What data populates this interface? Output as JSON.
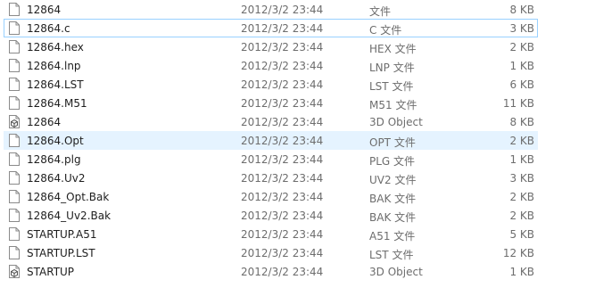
{
  "files": [
    {
      "name": "12864",
      "date": "2012/3/2 23:44",
      "type": "文件",
      "size": "8 KB",
      "icon": "file-icon"
    },
    {
      "name": "12864.c",
      "date": "2012/3/2 23:44",
      "type": "C 文件",
      "size": "3 KB",
      "icon": "file-icon",
      "state": "focused"
    },
    {
      "name": "12864.hex",
      "date": "2012/3/2 23:44",
      "type": "HEX 文件",
      "size": "2 KB",
      "icon": "file-icon"
    },
    {
      "name": "12864.lnp",
      "date": "2012/3/2 23:44",
      "type": "LNP 文件",
      "size": "1 KB",
      "icon": "file-icon"
    },
    {
      "name": "12864.LST",
      "date": "2012/3/2 23:44",
      "type": "LST 文件",
      "size": "6 KB",
      "icon": "file-icon"
    },
    {
      "name": "12864.M51",
      "date": "2012/3/2 23:44",
      "type": "M51 文件",
      "size": "11 KB",
      "icon": "file-icon"
    },
    {
      "name": "12864",
      "date": "2012/3/2 23:44",
      "type": "3D Object",
      "size": "8 KB",
      "icon": "3d-object-icon"
    },
    {
      "name": "12864.Opt",
      "date": "2012/3/2 23:44",
      "type": "OPT 文件",
      "size": "2 KB",
      "icon": "file-icon",
      "state": "hovered"
    },
    {
      "name": "12864.plg",
      "date": "2012/3/2 23:44",
      "type": "PLG 文件",
      "size": "1 KB",
      "icon": "file-icon"
    },
    {
      "name": "12864.Uv2",
      "date": "2012/3/2 23:44",
      "type": "UV2 文件",
      "size": "3 KB",
      "icon": "file-icon"
    },
    {
      "name": "12864_Opt.Bak",
      "date": "2012/3/2 23:44",
      "type": "BAK 文件",
      "size": "2 KB",
      "icon": "file-icon"
    },
    {
      "name": "12864_Uv2.Bak",
      "date": "2012/3/2 23:44",
      "type": "BAK 文件",
      "size": "2 KB",
      "icon": "file-icon"
    },
    {
      "name": "STARTUP.A51",
      "date": "2012/3/2 23:44",
      "type": "A51 文件",
      "size": "5 KB",
      "icon": "file-icon"
    },
    {
      "name": "STARTUP.LST",
      "date": "2012/3/2 23:44",
      "type": "LST 文件",
      "size": "12 KB",
      "icon": "file-icon"
    },
    {
      "name": "STARTUP",
      "date": "2012/3/2 23:44",
      "type": "3D Object",
      "size": "1 KB",
      "icon": "3d-object-icon"
    }
  ],
  "colors": {
    "focus_border": "#99d1ff",
    "hover_background": "#e5f3ff",
    "secondary_text": "#6d6d6d",
    "primary_text": "#1e1e1e"
  }
}
